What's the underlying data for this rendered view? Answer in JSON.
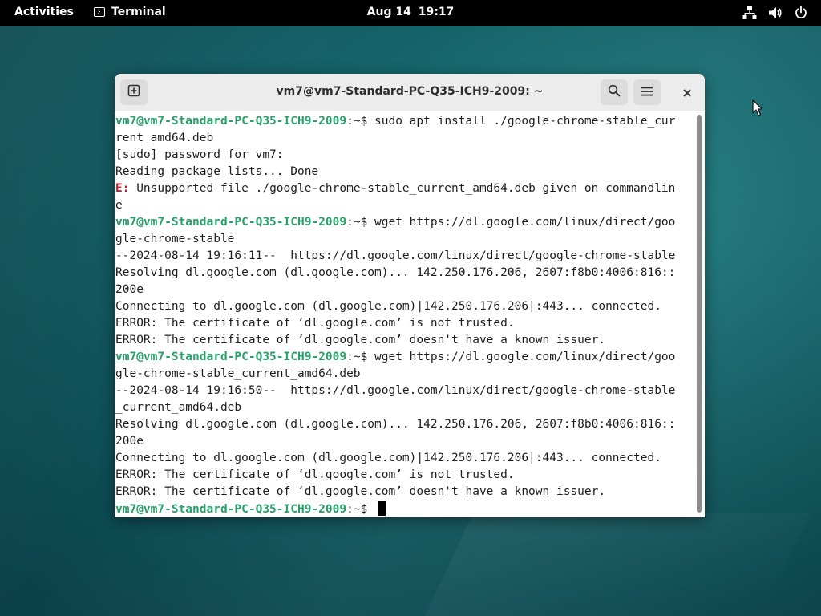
{
  "topbar": {
    "activities_label": "Activities",
    "app_name": "Terminal",
    "date": "Aug 14",
    "time": "19:17",
    "tray_icons": [
      "network-icon",
      "volume-icon",
      "power-icon"
    ]
  },
  "window": {
    "title": "vm7@vm7-Standard-PC-Q35-ICH9-2009: ~",
    "buttons": [
      "new-tab-icon",
      "search-icon",
      "hamburger-menu-icon",
      "close-icon"
    ]
  },
  "terminal": {
    "prompt": "vm7@vm7-Standard-PC-Q35-ICH9-2009",
    "prompt_suffix": ":~$ ",
    "lines": [
      {
        "kind": "cmd",
        "text": "sudo apt install ./google-chrome-stable_cur"
      },
      {
        "kind": "out",
        "text": "rent_amd64.deb"
      },
      {
        "kind": "out",
        "text": "[sudo] password for vm7:"
      },
      {
        "kind": "out",
        "text": "Reading package lists... Done"
      },
      {
        "kind": "err",
        "mark": "E:",
        "text": " Unsupported file ./google-chrome-stable_current_amd64.deb given on commandlin"
      },
      {
        "kind": "out",
        "text": "e"
      },
      {
        "kind": "cmd",
        "text": "wget https://dl.google.com/linux/direct/goo"
      },
      {
        "kind": "out",
        "text": "gle-chrome-stable"
      },
      {
        "kind": "out",
        "text": "--2024-08-14 19:16:11--  https://dl.google.com/linux/direct/google-chrome-stable"
      },
      {
        "kind": "out",
        "text": "Resolving dl.google.com (dl.google.com)... 142.250.176.206, 2607:f8b0:4006:816::"
      },
      {
        "kind": "out",
        "text": "200e"
      },
      {
        "kind": "out",
        "text": "Connecting to dl.google.com (dl.google.com)|142.250.176.206|:443... connected."
      },
      {
        "kind": "out",
        "text": "ERROR: The certificate of ‘dl.google.com’ is not trusted."
      },
      {
        "kind": "out",
        "text": "ERROR: The certificate of ‘dl.google.com’ doesn't have a known issuer."
      },
      {
        "kind": "cmd",
        "text": "wget https://dl.google.com/linux/direct/goo"
      },
      {
        "kind": "out",
        "text": "gle-chrome-stable_current_amd64.deb"
      },
      {
        "kind": "out",
        "text": "--2024-08-14 19:16:50--  https://dl.google.com/linux/direct/google-chrome-stable"
      },
      {
        "kind": "out",
        "text": "_current_amd64.deb"
      },
      {
        "kind": "out",
        "text": "Resolving dl.google.com (dl.google.com)... 142.250.176.206, 2607:f8b0:4006:816::"
      },
      {
        "kind": "out",
        "text": "200e"
      },
      {
        "kind": "out",
        "text": "Connecting to dl.google.com (dl.google.com)|142.250.176.206|:443... connected."
      },
      {
        "kind": "out",
        "text": "ERROR: The certificate of ‘dl.google.com’ is not trusted."
      },
      {
        "kind": "out",
        "text": "ERROR: The certificate of ‘dl.google.com’ doesn't have a known issuer."
      },
      {
        "kind": "cmd",
        "text": ""
      }
    ]
  },
  "colors": {
    "prompt": "#26a269",
    "error_mark": "#c01c28",
    "topbar": "#000000",
    "headerbar": "#ececec"
  }
}
